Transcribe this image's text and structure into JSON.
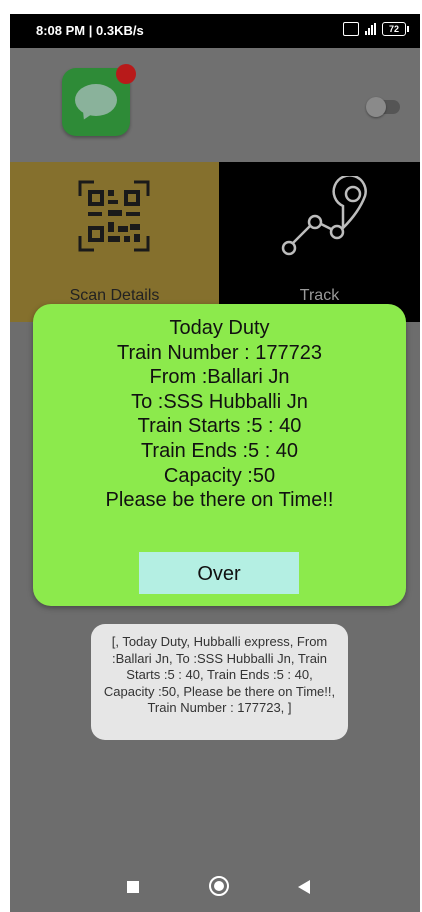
{
  "status_bar": {
    "time": "8:08 PM | 0.3KB/s",
    "network": "4G+",
    "battery": "72"
  },
  "app_bar": {
    "logo_icon": "message-bubble-icon",
    "toggle_state": "off"
  },
  "tiles": [
    {
      "label": "Scan Details",
      "icon": "qr-code-icon"
    },
    {
      "label": "Track",
      "icon": "route-icon"
    }
  ],
  "dialog": {
    "lines": [
      "Today Duty",
      "Train Number : 177723",
      "From :Ballari Jn",
      "To :SSS Hubballi Jn",
      "Train Starts :5 : 40",
      "Train Ends :5 : 40",
      "Capacity :50",
      "Please be there on Time!!"
    ],
    "button_label": "Over"
  },
  "toast": {
    "text": "[, Today Duty,  Hubballi express,  From :Ballari Jn,  To :SSS Hubballi Jn,  Train Starts :5 : 40,  Train Ends :5 : 40,  Capacity :50,  Please be there on Time!!,  Train Number : 177723, ]"
  },
  "colors": {
    "dialog_bg": "#8cea4c",
    "button_bg": "#b4efe3",
    "scan_tile_bg": "#85702d",
    "track_tile_bg": "#000000",
    "overlay_bg": "#6d6d6d"
  }
}
